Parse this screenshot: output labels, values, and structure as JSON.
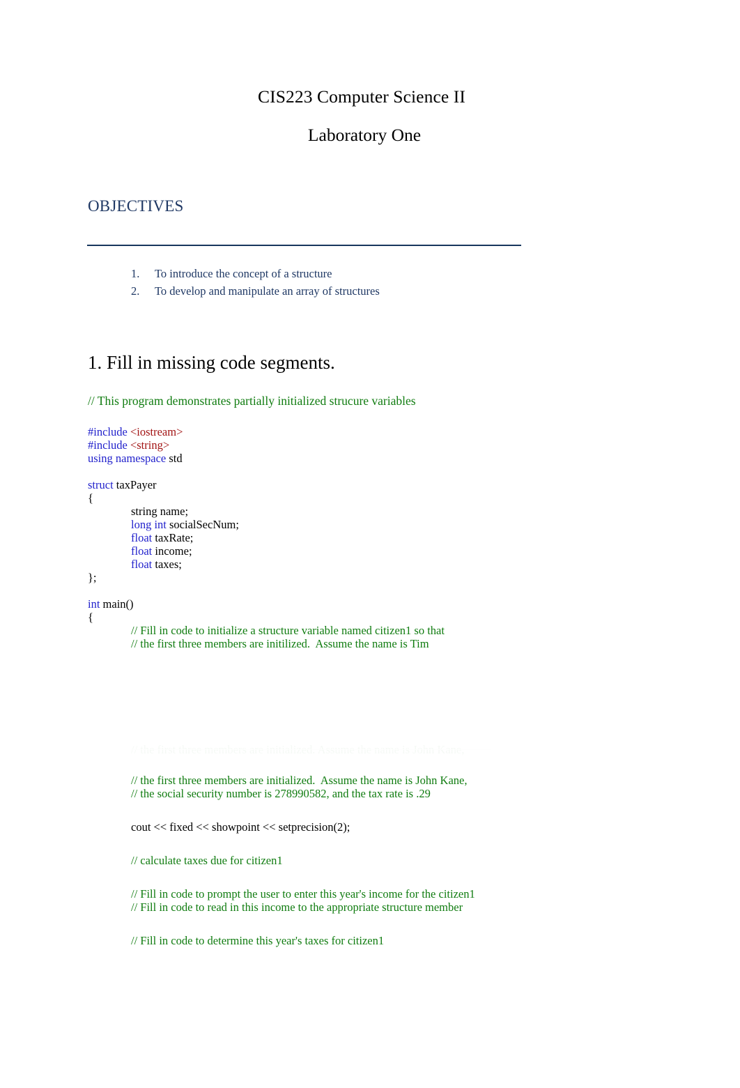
{
  "document": {
    "title": "CIS223 Computer Science II",
    "subtitle": "Laboratory One"
  },
  "objectives": {
    "heading": "OBJECTIVES",
    "items": [
      {
        "number": "1.",
        "text": "To introduce the concept of a structure"
      },
      {
        "number": "2.",
        "text": "To develop and manipulate an array of structures"
      }
    ]
  },
  "section": {
    "heading": "1. Fill in missing code segments.",
    "lead_comment": "// This program demonstrates partially initialized strucure variables"
  },
  "code": {
    "include_iostream_kw": "#include ",
    "include_iostream_hdr": "<iostream>",
    "include_string_kw": "#include ",
    "include_string_hdr": "<string>",
    "using_kw": "using namespace ",
    "using_name": "std",
    "struct_kw": "struct ",
    "struct_name": "taxPayer",
    "open_brace": "{",
    "member_string_name": "string name;",
    "member_long_kw": "long int ",
    "member_long_name": "socialSecNum;",
    "member_float1_kw": "float ",
    "member_float1_name": "taxRate;",
    "member_float2_kw": "float ",
    "member_float2_name": "income;",
    "member_float3_kw": "float ",
    "member_float3_name": "taxes;",
    "close_brace_semi": "};",
    "int_kw": "int ",
    "main_name": "main()",
    "main_open_brace": "{",
    "comment_fill_init_1": "// Fill in code to initialize a structure variable named citizen1 so that",
    "comment_fill_init_2": "// the first three members are initilized.  Assume the name is Tim",
    "comment_members_john": "// the first three members are initialized.  Assume the name is John Kane,",
    "comment_ssn_rate": "// the social security number is 278990582, and the tax rate is .29",
    "cout_line": "cout << fixed << showpoint << setprecision(2);",
    "comment_calculate": "// calculate taxes due for citizen1",
    "comment_prompt_income": "// Fill in code to prompt the user to enter this year's income for the citizen1",
    "comment_read_income": "// Fill in code to read in this income to the appropriate structure member",
    "comment_determine_taxes": "// Fill in code to determine this year's taxes for citizen1",
    "ghost_artifact_text": "// the first three members are initialized.  Assume the name is John Kane,"
  },
  "colors": {
    "keyword_blue": "#2222CC",
    "header_red": "#A31515",
    "comment_green": "#107C10",
    "heading_navy": "#1F3864",
    "rule_navy": "#17365D",
    "text_black": "#000000",
    "page_background": "#FFFFFF"
  }
}
